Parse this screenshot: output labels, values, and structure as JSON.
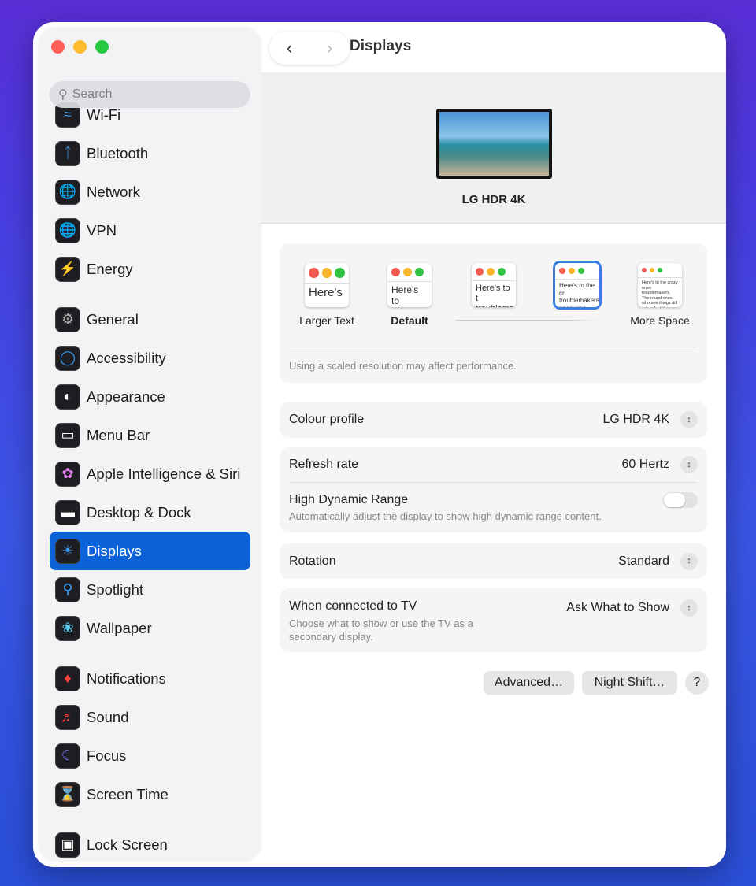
{
  "window": {
    "title": "Displays",
    "traffic_lights": [
      "#ff5f57",
      "#febc2e",
      "#28c840"
    ]
  },
  "sidebar": {
    "search_placeholder": "Search",
    "selected_color": "#0b63d7",
    "groups": [
      [
        {
          "label": "Wi-Fi",
          "icon": "wifi-icon",
          "color": "#3a9bf5"
        },
        {
          "label": "Bluetooth",
          "icon": "bluetooth-icon",
          "color": "#3a9bf5"
        },
        {
          "label": "Network",
          "icon": "globe-icon",
          "color": "#3a9bf5"
        },
        {
          "label": "VPN",
          "icon": "vpn-globe-icon",
          "color": "#3a9bf5"
        },
        {
          "label": "Energy",
          "icon": "bolt-icon",
          "color": "#34c759"
        }
      ],
      [
        {
          "label": "General",
          "icon": "gear-icon",
          "color": "#aaaaaa"
        },
        {
          "label": "Accessibility",
          "icon": "accessibility-icon",
          "color": "#3a9bf5"
        },
        {
          "label": "Appearance",
          "icon": "appearance-icon",
          "color": "#ffffff"
        },
        {
          "label": "Menu Bar",
          "icon": "menu-bar-icon",
          "color": "#ffffff"
        },
        {
          "label": "Apple Intelligence & Siri",
          "icon": "siri-icon",
          "color": "#e37cf0"
        },
        {
          "label": "Desktop & Dock",
          "icon": "dock-icon",
          "color": "#ffffff"
        },
        {
          "label": "Displays",
          "icon": "sun-icon",
          "color": "#3a9bf5",
          "selected": true
        },
        {
          "label": "Spotlight",
          "icon": "magnifier-icon",
          "color": "#3a9bf5"
        },
        {
          "label": "Wallpaper",
          "icon": "flower-icon",
          "color": "#5ad1f5"
        }
      ],
      [
        {
          "label": "Notifications",
          "icon": "bell-icon",
          "color": "#ff453a"
        },
        {
          "label": "Sound",
          "icon": "speaker-icon",
          "color": "#ff453a"
        },
        {
          "label": "Focus",
          "icon": "moon-icon",
          "color": "#7d7aff"
        },
        {
          "label": "Screen Time",
          "icon": "hourglass-icon",
          "color": "#a58cff"
        }
      ],
      [
        {
          "label": "Lock Screen",
          "icon": "lock-icon",
          "color": "#ffffff"
        }
      ]
    ]
  },
  "display": {
    "name": "LG HDR 4K"
  },
  "resolution": {
    "options": [
      {
        "label": "Larger Text",
        "preview": "Here's"
      },
      {
        "label": "Default",
        "preview": "Here's to troublem"
      },
      {
        "label": "",
        "preview": "Here's to t troublema ones who"
      },
      {
        "label": "",
        "preview": "Here's to the cr troublemakers. ones who see t rules. And they",
        "selected": true
      },
      {
        "label": "More Space",
        "preview": "Here's to the crazy ones troublemakers. The round ones who see things diff rules. And they have no can quote them, disagre them. About the only th Because they change th"
      }
    ],
    "note": "Using a scaled resolution may affect performance."
  },
  "settings": {
    "colour_profile": {
      "label": "Colour profile",
      "value": "LG HDR 4K"
    },
    "refresh_rate": {
      "label": "Refresh rate",
      "value": "60 Hertz"
    },
    "hdr": {
      "label": "High Dynamic Range",
      "description": "Automatically adjust the display to show high dynamic range content.",
      "enabled": false
    },
    "rotation": {
      "label": "Rotation",
      "value": "Standard"
    },
    "tv": {
      "label": "When connected to TV",
      "description": "Choose what to show or use the TV as a secondary display.",
      "value": "Ask What to Show"
    }
  },
  "buttons": {
    "advanced": "Advanced…",
    "night_shift": "Night Shift…",
    "help": "?"
  }
}
